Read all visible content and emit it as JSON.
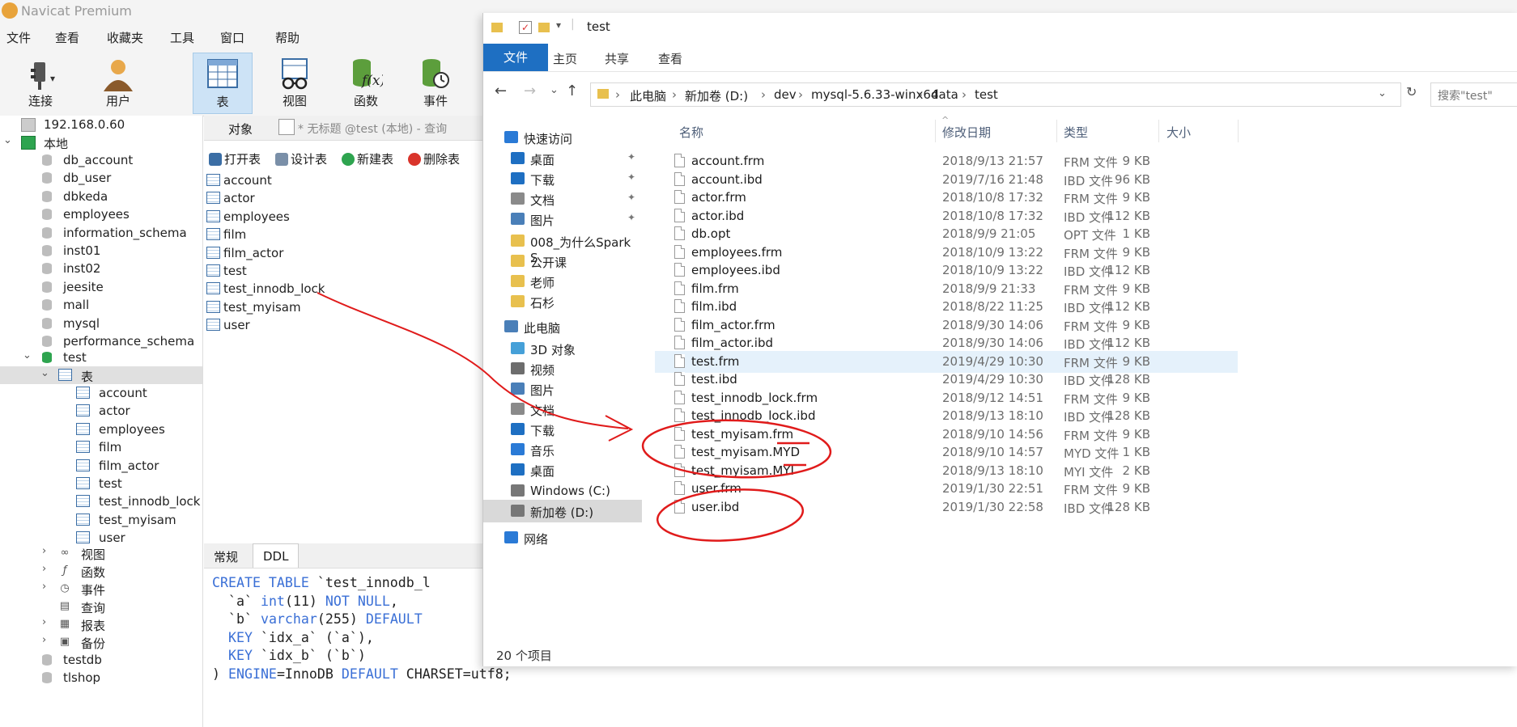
{
  "navicat": {
    "title": "Navicat Premium",
    "menu": [
      "文件",
      "查看",
      "收藏夹",
      "工具",
      "窗口",
      "帮助"
    ],
    "toolbar": [
      {
        "label": "连接",
        "icon": "plug-icon"
      },
      {
        "label": "用户",
        "icon": "user-icon"
      },
      {
        "label": "表",
        "icon": "table-icon",
        "active": true
      },
      {
        "label": "视图",
        "icon": "view-glasses-icon"
      },
      {
        "label": "函数",
        "icon": "function-icon"
      },
      {
        "label": "事件",
        "icon": "event-clock-icon"
      }
    ],
    "tree": {
      "remote": "192.168.0.60",
      "local": "本地",
      "databases": [
        "db_account",
        "db_user",
        "dbkeda",
        "employees",
        "information_schema",
        "inst01",
        "inst02",
        "jeesite",
        "mall",
        "mysql",
        "performance_schema"
      ],
      "current_db": "test",
      "tables_node": "表",
      "tables": [
        "account",
        "actor",
        "employees",
        "film",
        "film_actor",
        "test",
        "test_innodb_lock",
        "test_myisam",
        "user"
      ],
      "other_nodes": [
        "视图",
        "函数",
        "事件",
        "查询",
        "报表",
        "备份"
      ],
      "more_dbs": [
        "testdb",
        "tlshop"
      ]
    },
    "object_tab": "对象",
    "query_tab": "* 无标题 @test (本地) - 查询",
    "actions": [
      "打开表",
      "设计表",
      "新建表",
      "删除表"
    ],
    "table_list": [
      "account",
      "actor",
      "employees",
      "film",
      "film_actor",
      "test",
      "test_innodb_lock",
      "test_myisam",
      "user"
    ],
    "bottom_tabs": [
      "常规",
      "DDL"
    ],
    "ddl": {
      "l1_kw": "CREATE TABLE",
      "l1_rest": " `test_innodb_l",
      "l2_a": "  `a` ",
      "l2_type": "int",
      "l2_b": "(11) ",
      "l2_kw": "NOT NULL",
      "l2_c": ",",
      "l3_a": "  `b` ",
      "l3_type": "varchar",
      "l3_b": "(255) ",
      "l3_kw": "DEFAULT",
      "l4_kw": "  KEY",
      "l4_rest": " `idx_a` (`a`),",
      "l5_kw": "  KEY",
      "l5_rest": " `idx_b` (`b`)",
      "l6_a": ") ",
      "l6_kw1": "ENGINE",
      "l6_b": "=InnoDB ",
      "l6_kw2": "DEFAULT",
      "l6_c": " CHARSET=utf8;"
    }
  },
  "explorer": {
    "title": "test",
    "ribbon_tabs": [
      "文件",
      "主页",
      "共享",
      "查看"
    ],
    "breadcrumb": [
      "此电脑",
      "新加卷 (D:)",
      "dev",
      "mysql-5.6.33-winx64",
      "data",
      "test"
    ],
    "search_placeholder": "搜索\"test\"",
    "nav": [
      {
        "label": "快速访问",
        "icon": "star-icon"
      },
      {
        "label": "桌面",
        "icon": "desktop-icon",
        "pinned": true
      },
      {
        "label": "下载",
        "icon": "download-icon",
        "pinned": true
      },
      {
        "label": "文档",
        "icon": "document-icon",
        "pinned": true
      },
      {
        "label": "图片",
        "icon": "picture-icon",
        "pinned": true
      },
      {
        "label": "008_为什么Spark S",
        "icon": "folder-icon"
      },
      {
        "label": "公开课",
        "icon": "folder-icon"
      },
      {
        "label": "老师",
        "icon": "folder-icon"
      },
      {
        "label": "石杉",
        "icon": "folder-icon"
      },
      {
        "label": "此电脑",
        "icon": "computer-icon"
      },
      {
        "label": "3D 对象",
        "icon": "3d-objects-icon"
      },
      {
        "label": "视频",
        "icon": "video-icon"
      },
      {
        "label": "图片",
        "icon": "picture-icon"
      },
      {
        "label": "文档",
        "icon": "document-icon"
      },
      {
        "label": "下载",
        "icon": "download-icon"
      },
      {
        "label": "音乐",
        "icon": "music-icon"
      },
      {
        "label": "桌面",
        "icon": "desktop-icon"
      },
      {
        "label": "Windows (C:)",
        "icon": "drive-icon"
      },
      {
        "label": "新加卷 (D:)",
        "icon": "drive-icon"
      },
      {
        "label": "网络",
        "icon": "network-icon"
      }
    ],
    "columns": [
      "名称",
      "修改日期",
      "类型",
      "大小"
    ],
    "files": [
      {
        "name": "account.frm",
        "date": "2018/9/13 21:57",
        "type": "FRM 文件",
        "size": "9 KB"
      },
      {
        "name": "account.ibd",
        "date": "2019/7/16 21:48",
        "type": "IBD 文件",
        "size": "96 KB"
      },
      {
        "name": "actor.frm",
        "date": "2018/10/8 17:32",
        "type": "FRM 文件",
        "size": "9 KB"
      },
      {
        "name": "actor.ibd",
        "date": "2018/10/8 17:32",
        "type": "IBD 文件",
        "size": "112 KB"
      },
      {
        "name": "db.opt",
        "date": "2018/9/9 21:05",
        "type": "OPT 文件",
        "size": "1 KB"
      },
      {
        "name": "employees.frm",
        "date": "2018/10/9 13:22",
        "type": "FRM 文件",
        "size": "9 KB"
      },
      {
        "name": "employees.ibd",
        "date": "2018/10/9 13:22",
        "type": "IBD 文件",
        "size": "112 KB"
      },
      {
        "name": "film.frm",
        "date": "2018/9/9 21:33",
        "type": "FRM 文件",
        "size": "9 KB"
      },
      {
        "name": "film.ibd",
        "date": "2018/8/22 11:25",
        "type": "IBD 文件",
        "size": "112 KB"
      },
      {
        "name": "film_actor.frm",
        "date": "2018/9/30 14:06",
        "type": "FRM 文件",
        "size": "9 KB"
      },
      {
        "name": "film_actor.ibd",
        "date": "2018/9/30 14:06",
        "type": "IBD 文件",
        "size": "112 KB"
      },
      {
        "name": "test.frm",
        "date": "2019/4/29 10:30",
        "type": "FRM 文件",
        "size": "9 KB"
      },
      {
        "name": "test.ibd",
        "date": "2019/4/29 10:30",
        "type": "IBD 文件",
        "size": "128 KB"
      },
      {
        "name": "test_innodb_lock.frm",
        "date": "2018/9/12 14:51",
        "type": "FRM 文件",
        "size": "9 KB"
      },
      {
        "name": "test_innodb_lock.ibd",
        "date": "2018/9/13 18:10",
        "type": "IBD 文件",
        "size": "128 KB"
      },
      {
        "name": "test_myisam.frm",
        "date": "2018/9/10 14:56",
        "type": "FRM 文件",
        "size": "9 KB"
      },
      {
        "name": "test_myisam.MYD",
        "date": "2018/9/10 14:57",
        "type": "MYD 文件",
        "size": "1 KB"
      },
      {
        "name": "test_myisam.MYI",
        "date": "2018/9/13 18:10",
        "type": "MYI 文件",
        "size": "2 KB"
      },
      {
        "name": "user.frm",
        "date": "2019/1/30 22:51",
        "type": "FRM 文件",
        "size": "9 KB"
      },
      {
        "name": "user.ibd",
        "date": "2019/1/30 22:58",
        "type": "IBD 文件",
        "size": "128 KB"
      }
    ],
    "status": "20 个项目"
  },
  "colors": {
    "annotation": "#e01b1b",
    "ribbon_file_tab": "#1e6fc2",
    "selected_row": "#e5f1fb",
    "active_toolbar": "#cde3f6"
  }
}
